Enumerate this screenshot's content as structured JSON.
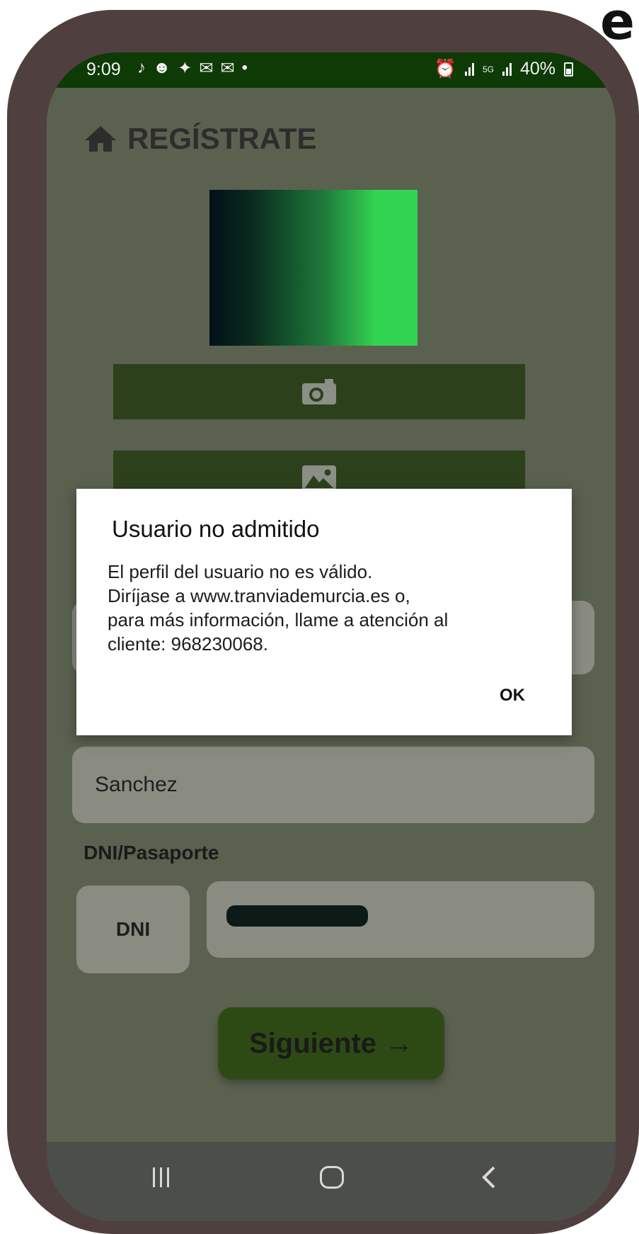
{
  "corner_glyph": "e",
  "status_bar": {
    "time": "9:09",
    "network": "5G",
    "battery": "40%"
  },
  "header": {
    "icon": "home-icon",
    "title": "REGÍSTRATE"
  },
  "media_buttons": {
    "camera_icon": "camera-icon",
    "gallery_icon": "image-icon"
  },
  "form": {
    "surname_value": "Sanchez",
    "document_label": "DNI/Pasaporte",
    "document_type": "DNI"
  },
  "next_button": {
    "label": "Siguiente",
    "arrow": "→"
  },
  "dialog": {
    "title": "Usuario no admitido",
    "message_lines": [
      "El perfil del usuario no es válido.",
      "Diríjase a www.tranviademurcia.es o,",
      "para más información, llame a atención al",
      "cliente: 968230068."
    ],
    "ok_label": "OK"
  },
  "colors": {
    "status_bar": "#0e3a05",
    "primary_button": "#2c411b",
    "frame": "#4f3f3e"
  }
}
